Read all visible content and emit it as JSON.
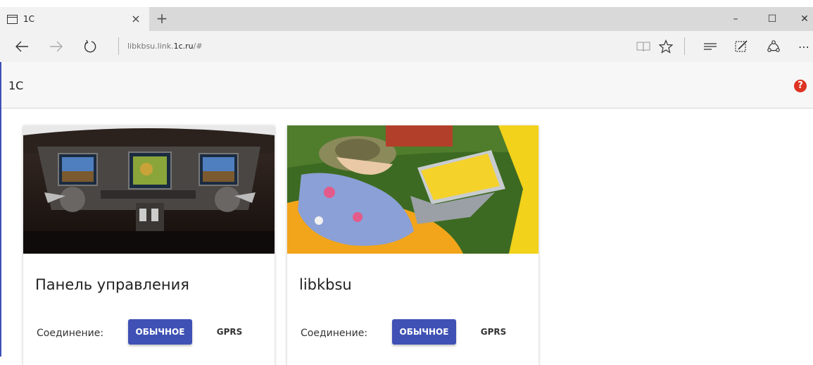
{
  "browser": {
    "tab_title": "1C",
    "tab_close": "×",
    "new_tab": "+",
    "url_prefix": "libkbsu.link.",
    "url_host": "1c.ru",
    "url_suffix": "/#",
    "window_controls": {
      "minimize": "–",
      "maximize": "☐",
      "close": "✕"
    },
    "more_label": "⋯"
  },
  "app": {
    "title": "1C",
    "help_label": "?"
  },
  "cards": [
    {
      "title": "Панель управления",
      "connection_label": "Соединение:",
      "primary_button": "ОБЫЧНОЕ",
      "secondary_button": "GPRS",
      "image": "cockpit-instrument-panel"
    },
    {
      "title": "libkbsu",
      "connection_label": "Соединение:",
      "primary_button": "ОБЫЧНОЕ",
      "secondary_button": "GPRS",
      "image": "woman-with-laptop-on-grass"
    }
  ],
  "colors": {
    "accent": "#3f51b5",
    "help": "#dd3322",
    "header_bg": "#f7f7f7",
    "browser_bg": "#f2f2f2"
  }
}
